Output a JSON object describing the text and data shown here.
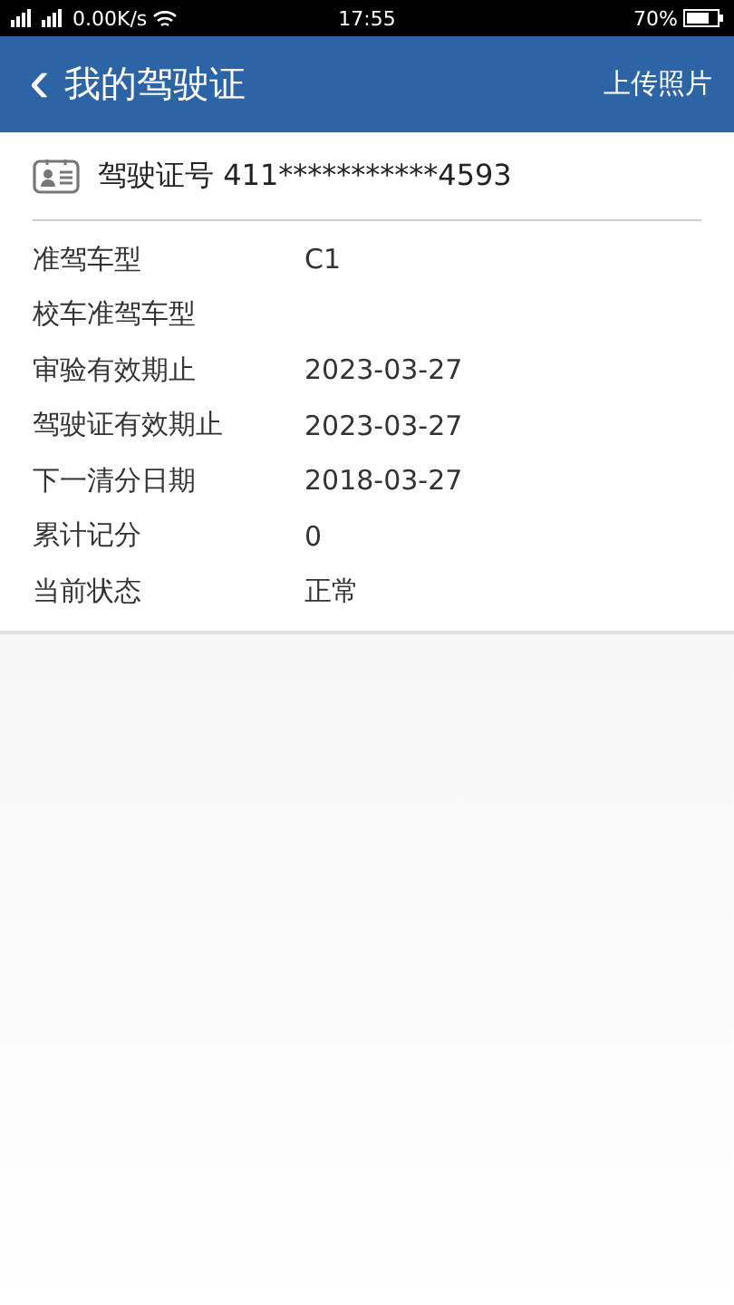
{
  "status_bar": {
    "speed": "0.00K/s",
    "time": "17:55",
    "battery": "70%"
  },
  "header": {
    "back": "‹",
    "title": "我的驾驶证",
    "action": "上传照片"
  },
  "license": {
    "label": "驾驶证号",
    "number": "411***********4593"
  },
  "fields": [
    {
      "label": "准驾车型",
      "value": "C1"
    },
    {
      "label": "校车准驾车型"
    },
    {
      "label": "审验有效期止",
      "value": "2023-03-27"
    },
    {
      "label": "驾驶证有效期止",
      "value": "2023-03-27"
    },
    {
      "label": "下一清分日期",
      "value": "2018-03-27"
    },
    {
      "label": "累计记分",
      "value": "0"
    },
    {
      "label": "当前状态",
      "value": "正常"
    }
  ]
}
